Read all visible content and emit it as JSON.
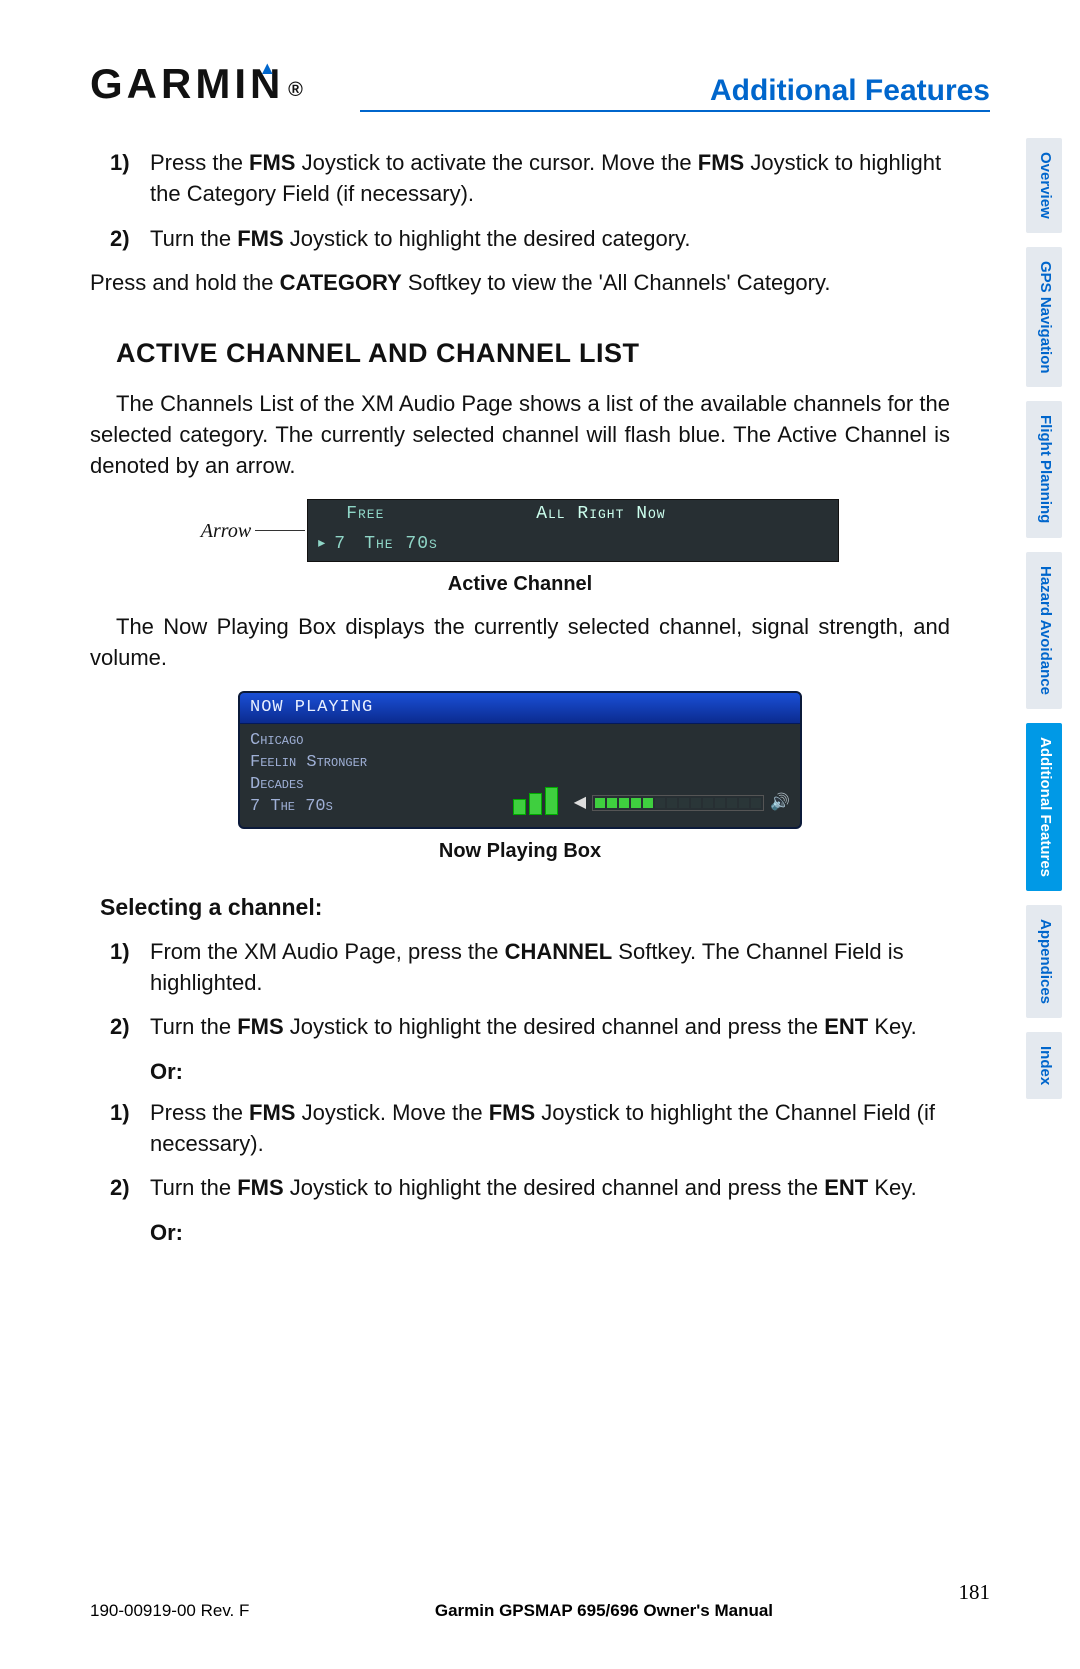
{
  "header": {
    "brand": "GARMIN",
    "title": "Additional Features"
  },
  "intro_steps": [
    {
      "num": "1)",
      "parts": [
        "Press the ",
        "FMS",
        " Joystick to activate the cursor.  Move the ",
        "FMS",
        " Joystick to highlight the Category Field (if necessary)."
      ]
    },
    {
      "num": "2)",
      "parts": [
        "Turn the ",
        "FMS",
        " Joystick to highlight the desired category."
      ]
    }
  ],
  "hold_line": {
    "parts": [
      "Press and hold the ",
      "CATEGORY",
      " Softkey to view the 'All Channels' Category."
    ]
  },
  "section_title": "ACTIVE CHANNEL AND CHANNEL LIST",
  "channels_para": "The Channels List of the XM Audio Page shows a list of the available channels for the selected category.  The currently selected channel will flash blue.  The Active Channel is denoted by an arrow.",
  "active_channel": {
    "arrow_label": "Arrow",
    "row1_c2": "Free",
    "row1_c3": "All Right Now",
    "row2_num": "7",
    "row2_name": "The 70s",
    "caption": "Active Channel"
  },
  "np_para": "The Now Playing Box displays the currently selected channel, signal strength, and volume.",
  "now_playing": {
    "title": "NOW PLAYING",
    "line1": "Chicago",
    "line2": "Feelin  Stronger",
    "line3": "Decades",
    "line4": "7 The 70s",
    "caption": "Now Playing Box"
  },
  "sub_heading": "Selecting a channel:",
  "steps_a": [
    {
      "num": "1)",
      "parts": [
        "From the XM Audio Page, press the ",
        "CHANNEL",
        " Softkey.  The Channel Field is highlighted."
      ]
    },
    {
      "num": "2)",
      "parts": [
        "Turn the ",
        "FMS",
        " Joystick to highlight the desired channel and press the ",
        "ENT",
        " Key."
      ]
    }
  ],
  "or_text": "Or:",
  "steps_b": [
    {
      "num": "1)",
      "parts": [
        "Press the ",
        "FMS",
        " Joystick.  Move the ",
        "FMS",
        " Joystick to highlight the Channel Field (if necessary)."
      ]
    },
    {
      "num": "2)",
      "parts": [
        "Turn the ",
        "FMS",
        " Joystick to highlight the desired channel and press the ",
        "ENT",
        " Key."
      ]
    }
  ],
  "tabs": [
    {
      "label": "Overview",
      "active": false
    },
    {
      "label": "GPS Navigation",
      "active": false
    },
    {
      "label": "Flight Planning",
      "active": false
    },
    {
      "label": "Hazard Avoidance",
      "active": false
    },
    {
      "label": "Additional Features",
      "active": true
    },
    {
      "label": "Appendices",
      "active": false
    },
    {
      "label": "Index",
      "active": false
    }
  ],
  "footer": {
    "rev": "190-00919-00  Rev. F",
    "manual": "Garmin GPSMAP 695/696 Owner's Manual",
    "page": "181"
  }
}
